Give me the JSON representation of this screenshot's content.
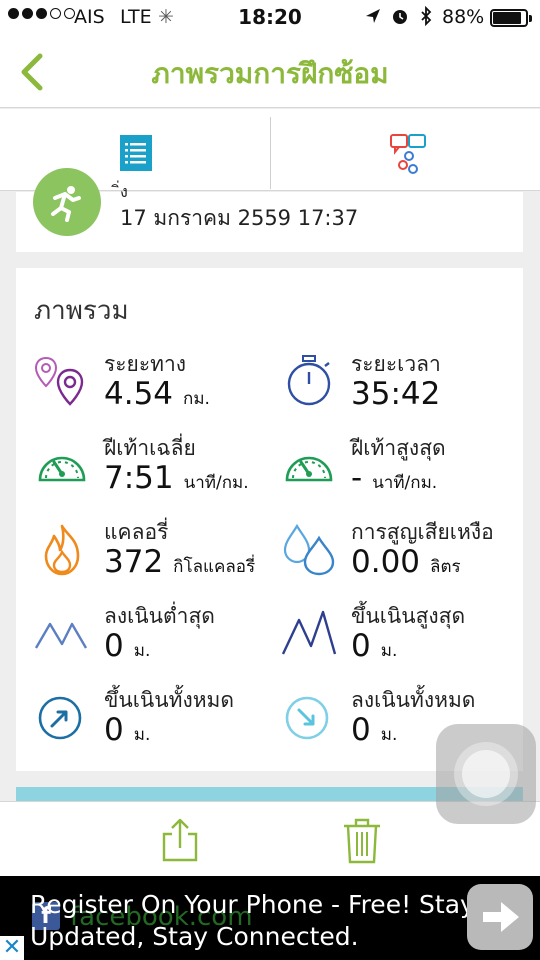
{
  "status_bar": {
    "carrier": "AIS",
    "network": "LTE",
    "time": "18:20",
    "battery_text": "88%",
    "battery_level": 0.88
  },
  "nav": {
    "title": "ภาพรวมการฝึกซ้อม",
    "accent": "#8cb93b"
  },
  "activity": {
    "datetime": "17 มกราคม 2559 17:37"
  },
  "summary": {
    "heading": "ภาพรวม",
    "stats": [
      {
        "label": "ระยะทาง",
        "value": "4.54",
        "unit": "กม.",
        "icon": "location-pins-icon"
      },
      {
        "label": "ระยะเวลา",
        "value": "35:42",
        "unit": "",
        "icon": "stopwatch-icon"
      },
      {
        "label": "ฝีเท้าเฉลี่ย",
        "value": "7:51",
        "unit": "นาที/กม.",
        "icon": "speedometer-icon"
      },
      {
        "label": "ฝีเท้าสูงสุด",
        "value": "-",
        "unit": "นาที/กม.",
        "icon": "speedometer-icon"
      },
      {
        "label": "แคลอรี่",
        "value": "372",
        "unit": "กิโลแคลอรี่",
        "icon": "flame-icon"
      },
      {
        "label": "การสูญเสียเหงือ",
        "value": "0.00",
        "unit": "ลิตร",
        "icon": "drops-icon"
      },
      {
        "label": "ลงเนินต่ำสุด",
        "value": "0",
        "unit": "ม.",
        "icon": "low-mountains-icon"
      },
      {
        "label": "ขึ้นเนินสูงสุด",
        "value": "0",
        "unit": "ม.",
        "icon": "high-mountains-icon"
      },
      {
        "label": "ขึ้นเนินทั้งหมด",
        "value": "0",
        "unit": "ม.",
        "icon": "arrow-up-circle-icon"
      },
      {
        "label": "ลงเนินทั้งหมด",
        "value": "0",
        "unit": "ม.",
        "icon": "arrow-down-circle-icon"
      }
    ]
  },
  "ad": {
    "brand_text": "facebook.com",
    "line1": "Register On Your Phone - Free! Stay",
    "line2": "Updated, Stay Connected.",
    "close_label": "✕"
  }
}
